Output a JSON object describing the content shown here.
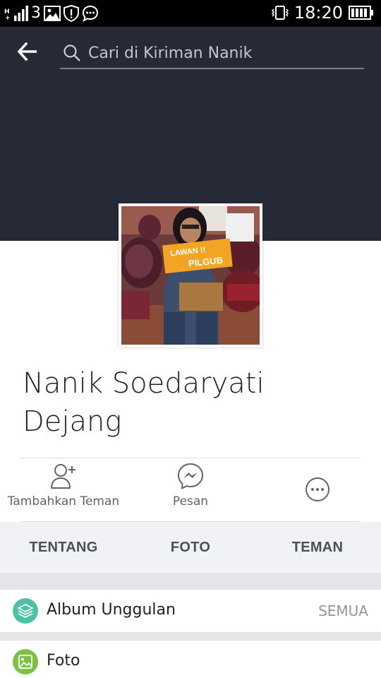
{
  "status_bar": {
    "network": "3",
    "time": "18:20",
    "icons": [
      "h-plus-icon",
      "signal-icon",
      "image-notification-icon",
      "shield-notification-icon",
      "chat-notification-icon",
      "vibrate-icon",
      "battery-icon"
    ]
  },
  "header": {
    "back_icon": "arrow-left-icon",
    "search_placeholder": "Cari di Kiriman Nanik",
    "search_icon": "search-icon"
  },
  "profile": {
    "name_line1": "Nanik Soedaryati",
    "name_line2": "Dejang",
    "photo_sign_text": "LAWAN !! PILGUB"
  },
  "actions": [
    {
      "label": "Tambahkan Teman",
      "icon": "add-friend-icon"
    },
    {
      "label": "Pesan",
      "icon": "messenger-icon"
    },
    {
      "label": "",
      "icon": "more-icon"
    }
  ],
  "tabs": [
    "TENTANG",
    "FOTO",
    "TEMAN"
  ],
  "sections": [
    {
      "label": "Album Unggulan",
      "link": "SEMUA",
      "icon": "album-stack-icon",
      "color": "#4fbfa5"
    },
    {
      "label": "Foto",
      "icon": "photo-icon",
      "color": "#7bc143"
    }
  ],
  "colors": {
    "header_bg": "#252a36",
    "tabs_bg": "#f0f2f5",
    "text": "#1d2129"
  }
}
